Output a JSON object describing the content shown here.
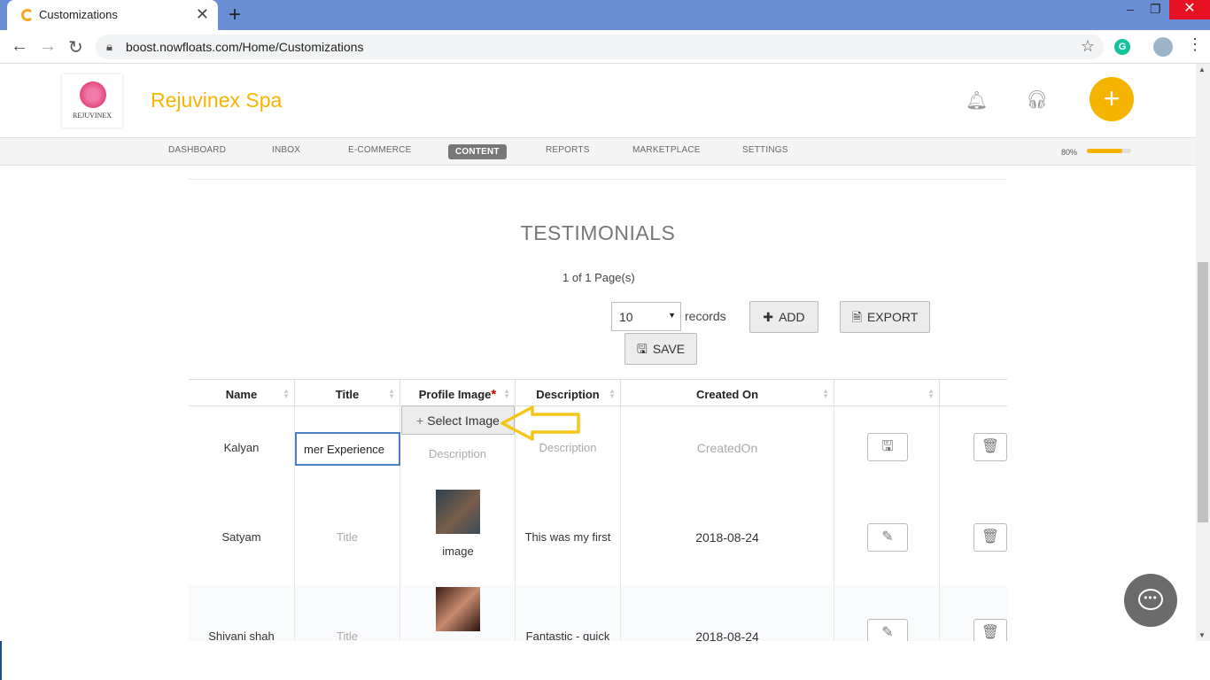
{
  "browser": {
    "tab_title": "Customizations",
    "tab_close": "✕",
    "new_tab": "+",
    "url": "boost.nowfloats.com/Home/Customizations",
    "win_min": "–",
    "win_restore": "❐",
    "win_close": "✕"
  },
  "header": {
    "logo_text": "REJUVINEX",
    "brand_name": "Rejuvinex Spa",
    "add_button": "+"
  },
  "nav": {
    "items": [
      "DASHBOARD",
      "INBOX",
      "E-COMMERCE",
      "CONTENT",
      "REPORTS",
      "MARKETPLACE",
      "SETTINGS"
    ],
    "active": "CONTENT"
  },
  "progress": {
    "label": "80%",
    "value": 0.8
  },
  "page": {
    "title": "TESTIMONIALS",
    "pagination": "1 of 1 Page(s)",
    "records_select": "10",
    "records_label": "records",
    "add_label": "ADD",
    "export_label": "EXPORT",
    "save_label": "SAVE"
  },
  "table": {
    "headers": [
      "Name",
      "Title",
      "Profile Image",
      "Description",
      "Created On",
      "",
      ""
    ],
    "required_mark": "*",
    "select_image_label": "Select Image",
    "rows": [
      {
        "name": "Kalyan",
        "title": "mer Experience",
        "image": "Description",
        "description": "Description",
        "created": "CreatedOn"
      },
      {
        "name": "Satyam",
        "title": "Title",
        "image": "image",
        "description": "This was my first",
        "created": "2018-08-24"
      },
      {
        "name": "Shivani shah",
        "title": "Title",
        "image": "",
        "description": "Fantastic - quick",
        "created": "2018-08-24"
      }
    ]
  },
  "icons": {
    "bell": "bell-icon",
    "headset": "headset-icon",
    "chat": "chat-icon",
    "save": "floppy-icon",
    "edit": "edit-icon",
    "trash": "trash-icon"
  },
  "colors": {
    "accent": "#f5b400",
    "tabbar": "#6a8ed6",
    "focus": "#4d7fc6",
    "annotation_arrow": "#f5c518"
  }
}
